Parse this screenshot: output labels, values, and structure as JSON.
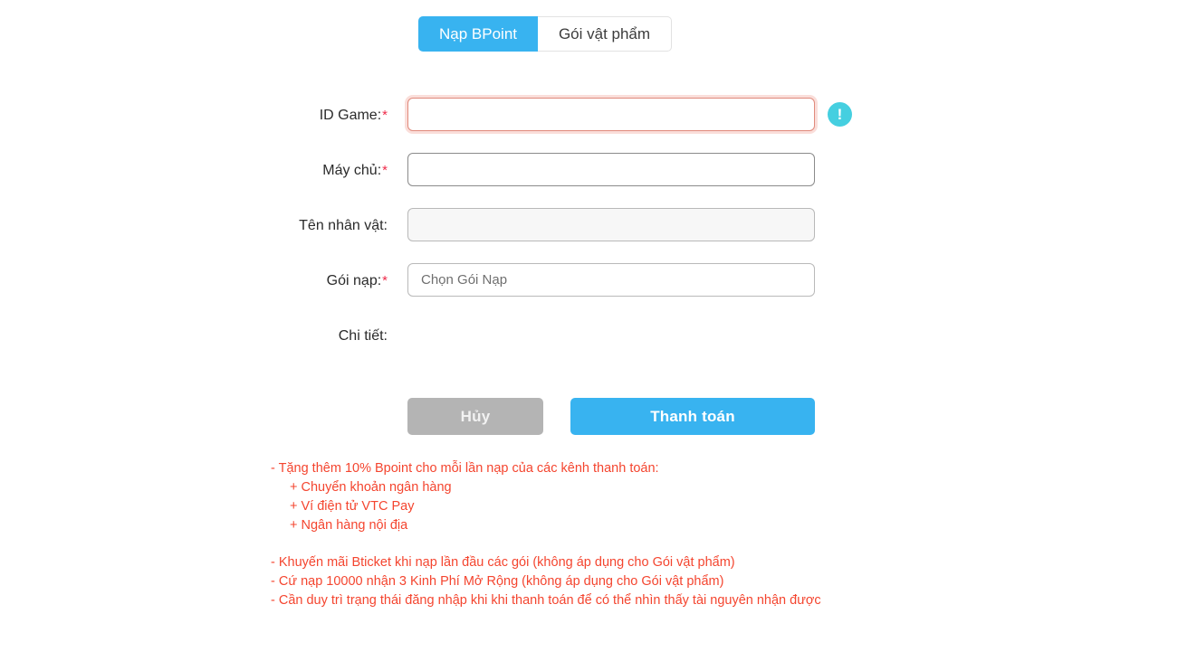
{
  "tabs": [
    {
      "label": "Nạp BPoint",
      "active": true
    },
    {
      "label": "Gói vật phẩm",
      "active": false
    }
  ],
  "form": {
    "fields": [
      {
        "label": "ID Game:",
        "required": true,
        "value": "",
        "placeholder": "",
        "state": "focused-error",
        "has_info_icon": true
      },
      {
        "label": "Máy chủ:",
        "required": true,
        "value": "",
        "placeholder": "",
        "state": "normal",
        "has_info_icon": false
      },
      {
        "label": "Tên nhân vật:",
        "required": false,
        "value": "",
        "placeholder": "",
        "state": "disabled",
        "has_info_icon": false
      },
      {
        "label": "Gói nạp:",
        "required": true,
        "value": "",
        "placeholder": "Chọn Gói Nạp",
        "state": "select",
        "has_info_icon": false
      },
      {
        "label": "Chi tiết:",
        "required": false,
        "state": "label-only",
        "has_info_icon": false
      }
    ],
    "required_marker": "*"
  },
  "buttons": {
    "cancel_label": "Hủy",
    "pay_label": "Thanh toán"
  },
  "info_icon": {
    "glyph": "!",
    "name": "exclamation-icon"
  },
  "notes": {
    "block1": {
      "heading": "- Tặng thêm 10% Bpoint cho mỗi lần nạp của các kênh thanh toán:",
      "items": [
        "+ Chuyển khoản ngân hàng",
        "+ Ví điện tử VTC Pay",
        "+ Ngân hàng nội địa"
      ]
    },
    "block2": [
      "- Khuyến mãi Bticket khi nạp lần đầu các gói (không áp dụng cho Gói vật phẩm)",
      "- Cứ nạp 10000 nhận 3 Kinh Phí Mở Rộng (không áp dụng cho Gói vật phẩm)",
      "- Cần duy trì trạng thái đăng nhập khi khi thanh toán để có thể nhìn thấy tài nguyên nhận được"
    ]
  },
  "colors": {
    "accent_blue": "#38b3f0",
    "info_cyan": "#45cfe0",
    "note_red": "#f4452f",
    "required_red": "#ee2b4a",
    "cancel_grey": "#b4b4b4",
    "error_border": "#e08a7c"
  }
}
